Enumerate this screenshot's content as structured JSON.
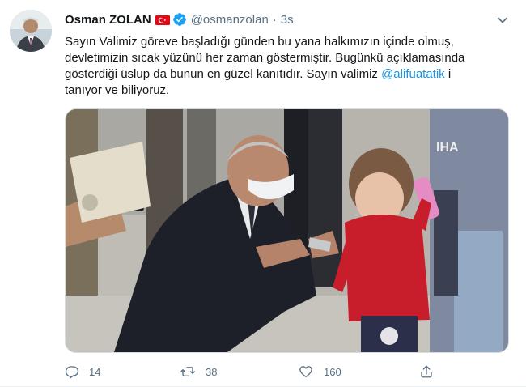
{
  "tweet": {
    "author_name": "Osman ZOLAN",
    "handle": "@osmanzolan",
    "separator": "·",
    "time": "3s",
    "text_line1": "Sayın Valimiz göreve başladığı günden bu yana halkımızın içinde olmuş,",
    "text_line2": "devletimizin sıcak yüzünü her zaman göstermiştir. Bugünkü açıklamasında",
    "text_line3_pre": "gösterdiği üslup da bunun en güzel kanıtıdır. Sayın valimiz ",
    "mention": "@alifuatatik",
    "text_line3_post": " i",
    "text_line4": "tanıyor ve biliyoruz.",
    "media_watermark": "IHA"
  },
  "actions": {
    "reply_count": "14",
    "retweet_count": "38",
    "like_count": "160"
  },
  "colors": {
    "accent": "#1b95e0",
    "verified": "#1da1f2",
    "secondary_text": "#5b7083",
    "flag_red": "#e30a17"
  },
  "icons": {
    "more": "chevron-down-icon",
    "reply": "reply-icon",
    "retweet": "retweet-icon",
    "like": "heart-icon",
    "share": "share-icon"
  }
}
